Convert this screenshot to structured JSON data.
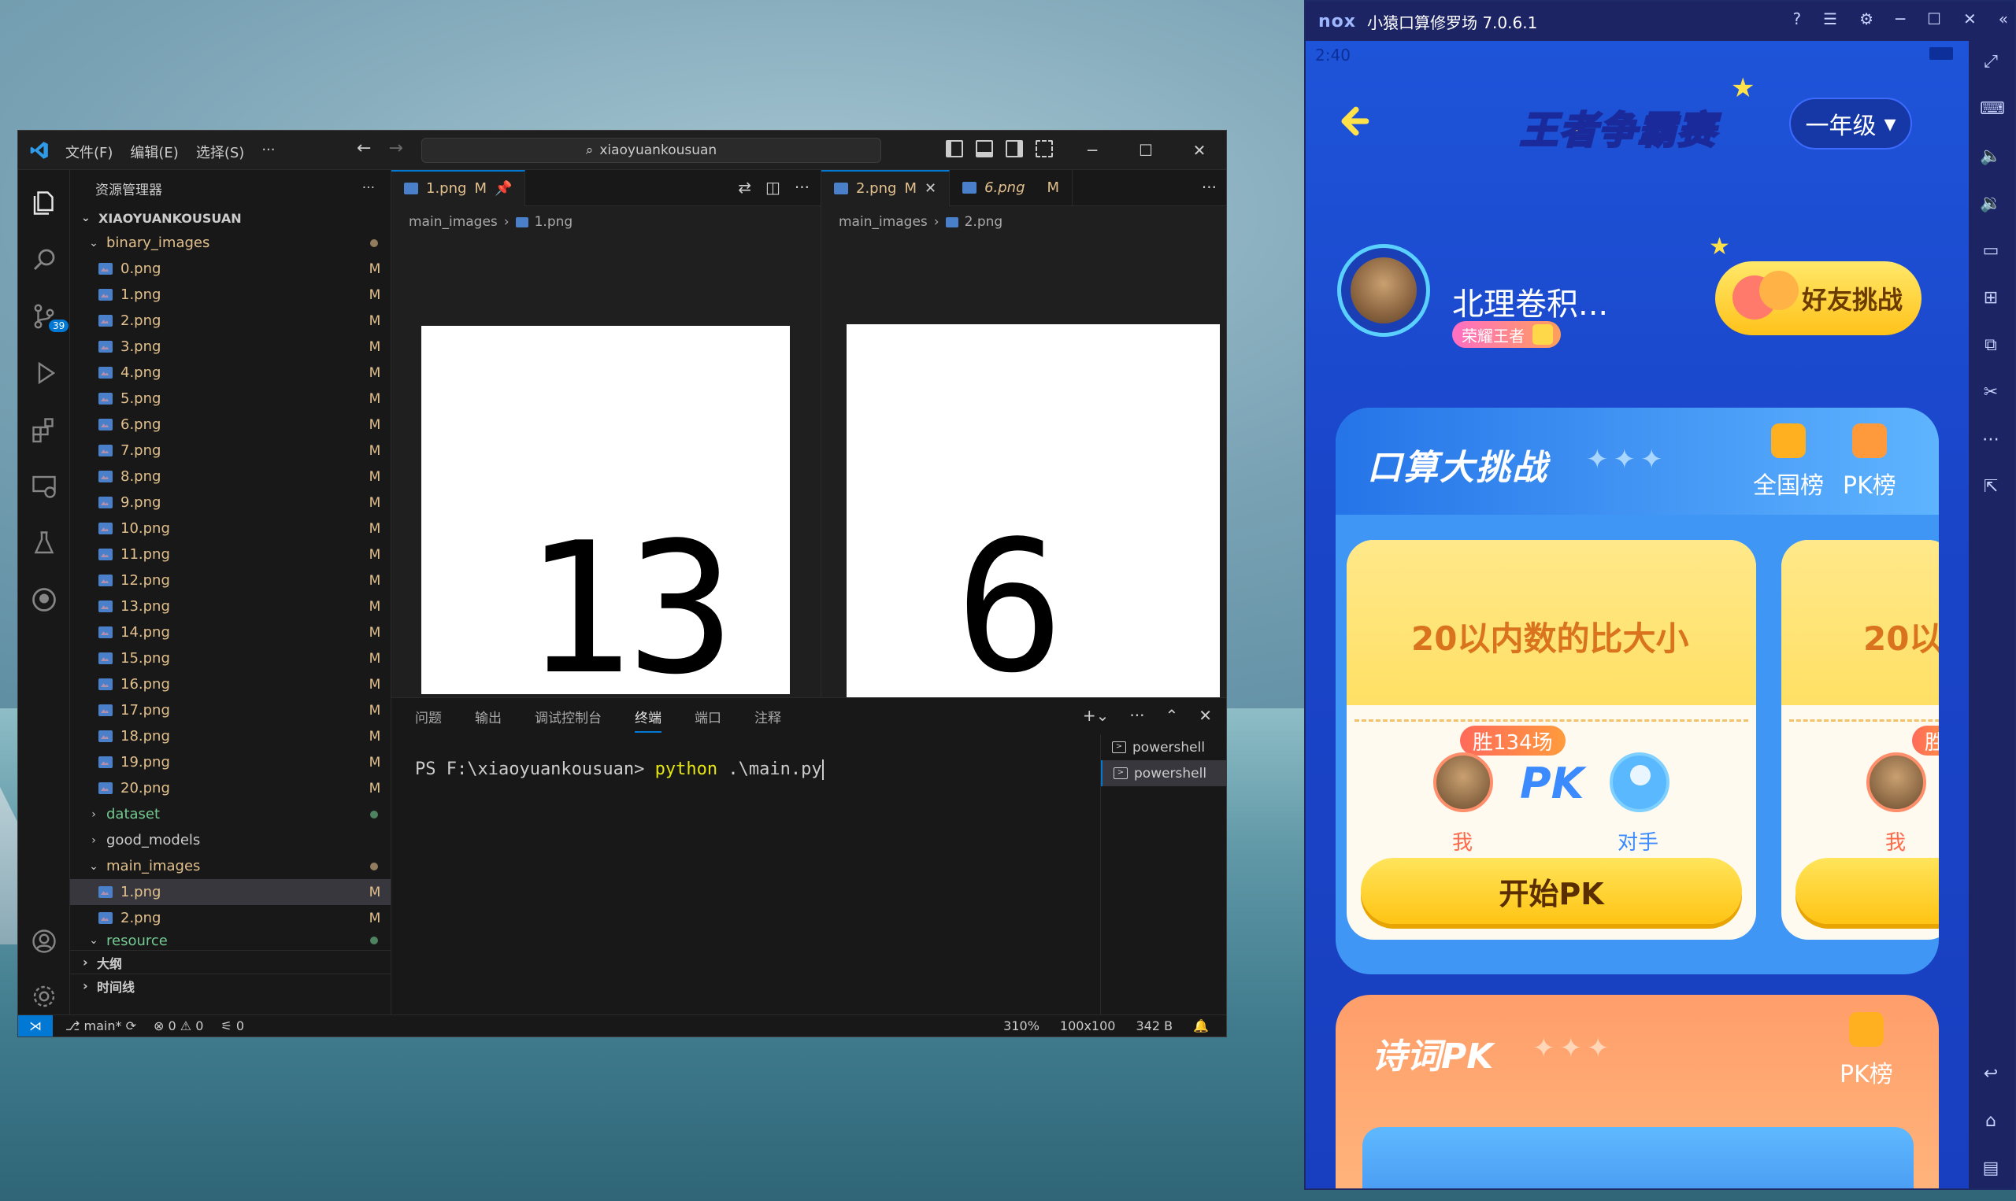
{
  "vscode": {
    "menus": [
      "文件(F)",
      "编辑(E)",
      "选择(S)",
      "···"
    ],
    "search_text": "xiaoyuankousuan",
    "sidebar_title": "资源管理器",
    "sidebar_more": "···",
    "root": "XIAOYUANKOUSUAN",
    "badge": "39",
    "tree": {
      "binary_images": "binary_images",
      "files": [
        "0.png",
        "1.png",
        "2.png",
        "3.png",
        "4.png",
        "5.png",
        "6.png",
        "7.png",
        "8.png",
        "9.png",
        "10.png",
        "11.png",
        "12.png",
        "13.png",
        "14.png",
        "15.png",
        "16.png",
        "17.png",
        "18.png",
        "19.png",
        "20.png"
      ],
      "mod_flag": "M",
      "dataset": "dataset",
      "good_models": "good_models",
      "main_images": "main_images",
      "main_files": [
        "1.png",
        "2.png"
      ],
      "resource": "resource"
    },
    "sections": [
      "大纲",
      "时间线"
    ],
    "editor_left": {
      "tab": "1.png",
      "tab_flag": "M",
      "crumb_folder": "main_images",
      "crumb_file": "1.png",
      "digits": "13"
    },
    "editor_right": {
      "tab1": "2.png",
      "tab1_flag": "M",
      "tab2": "6.png",
      "tab2_flag": "M",
      "crumb_folder": "main_images",
      "crumb_file": "2.png",
      "digits": "6"
    },
    "panel_tabs": [
      "问题",
      "输出",
      "调试控制台",
      "终端",
      "端口",
      "注释"
    ],
    "terminal": {
      "prompt": "PS F:\\xiaoyuankousuan> ",
      "command": "python",
      "args": " .\\main.py"
    },
    "terminals": [
      "powershell",
      "powershell"
    ],
    "status": {
      "branch": "main*",
      "errors": "0",
      "warnings": "0",
      "ports": "0",
      "zoom": "310%",
      "dims": "100x100",
      "size": "342 B"
    }
  },
  "nox": {
    "title": "小猿口算修罗场 7.0.6.1",
    "logo": "nox",
    "time": "2:40",
    "game_title": "王者争霸赛",
    "grade": "一年级",
    "username": "北理卷积...",
    "rank": "荣耀王者",
    "friend_btn": "好友挑战",
    "card1": {
      "title": "口算大挑战",
      "national": "全国榜",
      "pk_rank": "PK榜",
      "topic": "20以内数的比大小",
      "topic_clipped": "20以",
      "wins": "胜134场",
      "wins_clipped": "胜",
      "pk": "PK",
      "me": "我",
      "opponent": "对手",
      "start": "开始PK"
    },
    "card2": {
      "title": "诗词PK",
      "pk_rank": "PK榜"
    },
    "colors": {
      "primary_blue": "#1e54d9",
      "yellow": "#ffc414",
      "orange": "#ff9e6a"
    }
  }
}
